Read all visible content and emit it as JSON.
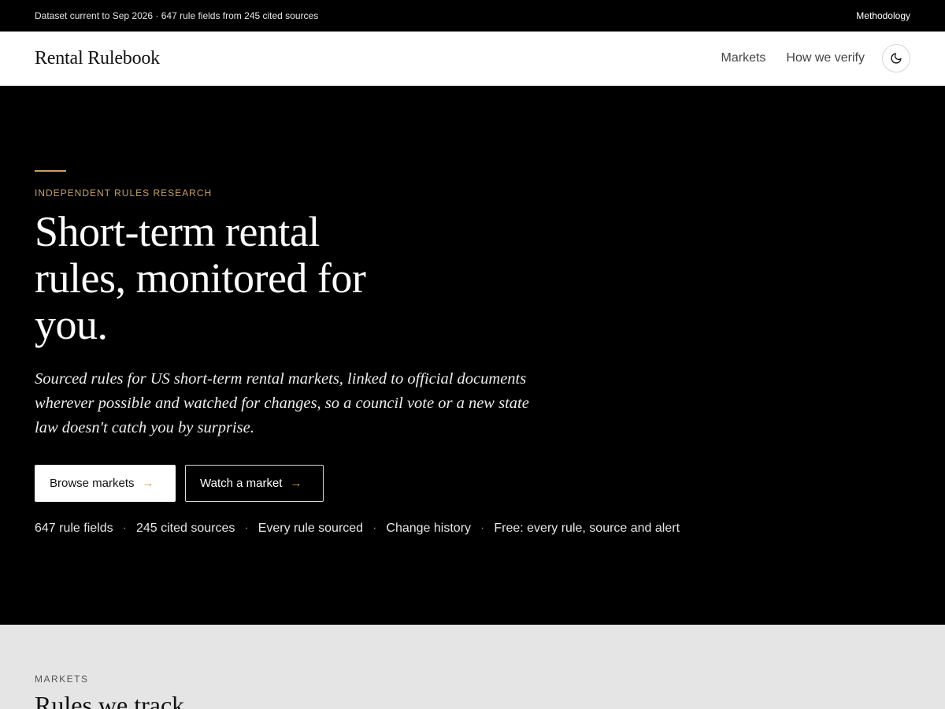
{
  "topbar": {
    "dataset_status": "Dataset current to Sep 2026 · 647 rule fields from 245 cited sources",
    "methodology_link": "Methodology"
  },
  "header": {
    "brand": "Rental Rulebook",
    "nav": [
      {
        "label": "Markets"
      },
      {
        "label": "How we verify"
      }
    ],
    "theme_toggle_icon": "moon-icon"
  },
  "hero": {
    "eyebrow": "INDEPENDENT RULES RESEARCH",
    "title": "Short-term rental rules, monitored for you.",
    "lead": "Sourced rules for US short-term rental markets, linked to official documents wherever possible and watched for changes, so a council vote or a new state law doesn't catch you by surprise.",
    "primary_cta": "Browse markets",
    "secondary_cta": "Watch a market",
    "stats": [
      "647 rule fields",
      "245 cited sources",
      "Every rule sourced",
      "Change history",
      "Free: every rule, source and alert"
    ],
    "separator": "·"
  },
  "markets": {
    "eyebrow": "MARKETS",
    "title": "Rules we track"
  },
  "colors": {
    "accent": "#c9a063",
    "background": "#000000",
    "section_bg": "#e5e5e5"
  }
}
